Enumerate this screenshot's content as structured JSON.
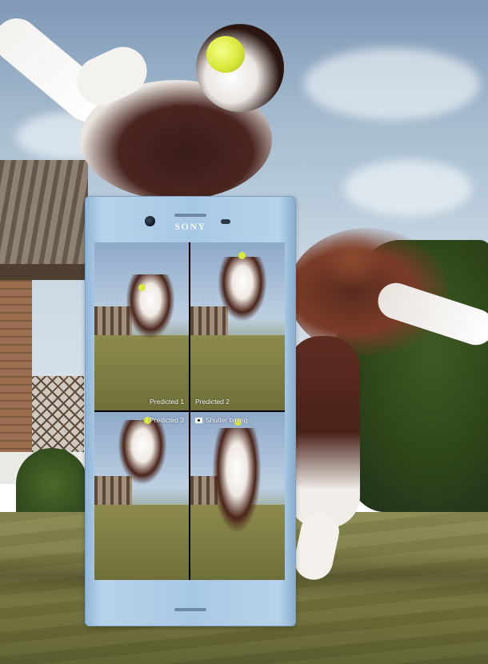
{
  "phone": {
    "brand": "SONY",
    "color": "#a9c8e3"
  },
  "shots": [
    {
      "label": "Predicted 1"
    },
    {
      "label": "Predicted 2"
    },
    {
      "label": "Predicted 3"
    },
    {
      "label": "Shutter timing",
      "icon": "camera-icon"
    }
  ],
  "scene": {
    "ball_color": "#d9e83a",
    "sky_color": "#a9bfd2",
    "grass_color": "#7b7a42"
  }
}
